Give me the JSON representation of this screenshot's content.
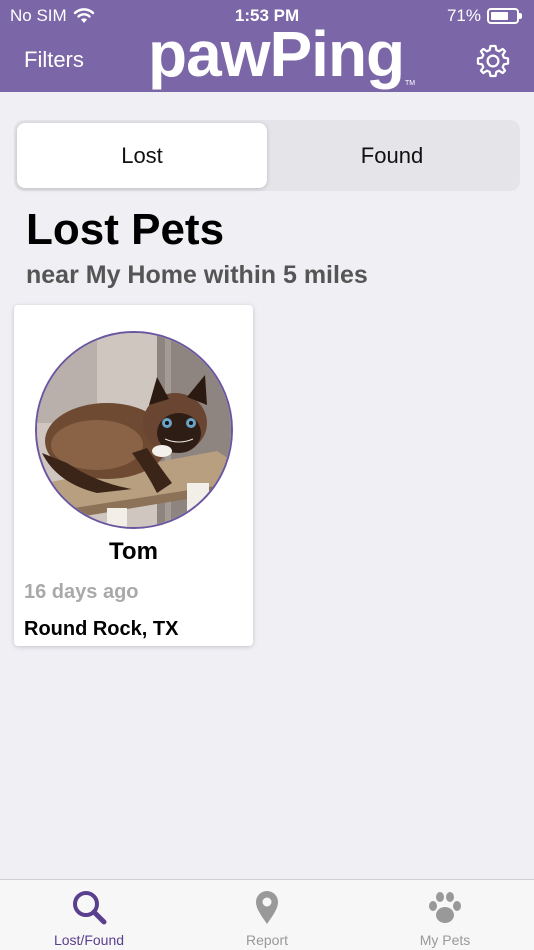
{
  "status_bar": {
    "carrier": "No SIM",
    "time": "1:53 PM",
    "battery": "71%",
    "battery_level": 0.71
  },
  "header": {
    "filters_label": "Filters",
    "logo": "pawPing",
    "trademark": "TM"
  },
  "segmented": {
    "options": [
      "Lost",
      "Found"
    ],
    "selected": "Lost"
  },
  "page": {
    "title": "Lost Pets",
    "subtitle": "near My Home within 5 miles"
  },
  "pets": [
    {
      "name": "Tom",
      "age": "16 days ago",
      "location": "Round Rock, TX"
    }
  ],
  "tabbar": {
    "tabs": [
      {
        "label": "Lost/Found",
        "icon": "search-icon",
        "active": true
      },
      {
        "label": "Report",
        "icon": "location-pin-icon",
        "active": false
      },
      {
        "label": "My Pets",
        "icon": "paw-icon",
        "active": false
      }
    ]
  },
  "colors": {
    "brand": "#7b67a7",
    "active_tab": "#5b3f8f",
    "inactive": "#999999"
  }
}
